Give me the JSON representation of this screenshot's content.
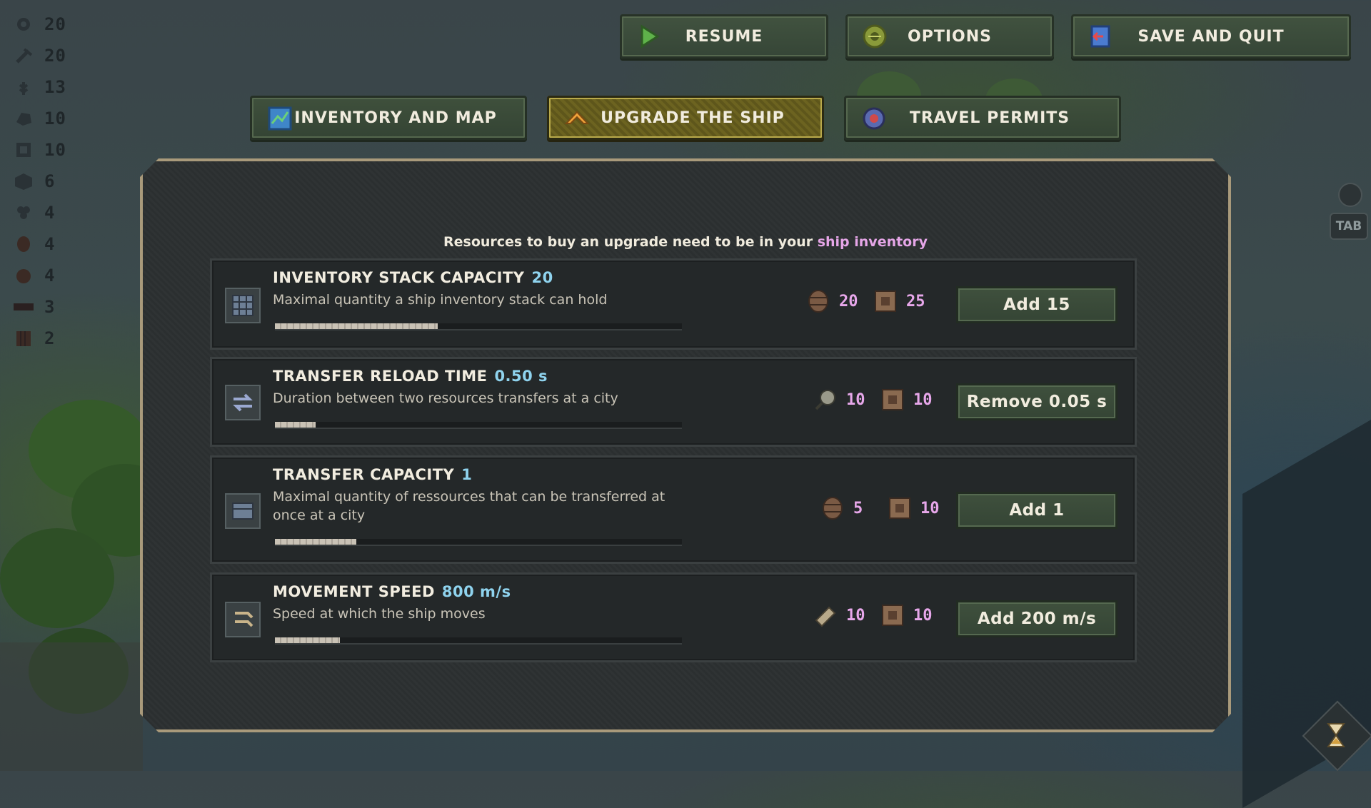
{
  "top_menu": {
    "resume_label": "RESUME",
    "options_label": "OPTIONS",
    "save_quit_label": "SAVE AND QUIT"
  },
  "tabs": [
    {
      "label": "INVENTORY AND MAP",
      "active": false
    },
    {
      "label": "UPGRADE THE SHIP",
      "active": true
    },
    {
      "label": "TRAVEL PERMITS",
      "active": false
    }
  ],
  "resource_hud": [
    {
      "icon": "gear-resource-icon",
      "value": "20"
    },
    {
      "icon": "pickaxe-resource-icon",
      "value": "20"
    },
    {
      "icon": "wheat-resource-icon",
      "value": "13"
    },
    {
      "icon": "ore-resource-icon",
      "value": "10"
    },
    {
      "icon": "crate-resource-icon",
      "value": "10"
    },
    {
      "icon": "box-resource-icon",
      "value": "6"
    },
    {
      "icon": "grapes-resource-icon",
      "value": "4"
    },
    {
      "icon": "barrel-resource-icon",
      "value": "4"
    },
    {
      "icon": "basket-resource-icon",
      "value": "4"
    },
    {
      "icon": "plank-resource-icon",
      "value": "3"
    },
    {
      "icon": "book-resource-icon",
      "value": "2"
    }
  ],
  "notice": {
    "text": "Resources to buy an upgrade need to be in your",
    "highlight": "ship inventory"
  },
  "upgrades": [
    {
      "title": "INVENTORY STACK CAPACITY",
      "value": "20",
      "description": "Maximal quantity a ship inventory stack can hold",
      "progress": 0.4,
      "costs": [
        {
          "icon": "barrel-resource-icon",
          "amount": "20"
        },
        {
          "icon": "crate-resource-icon",
          "amount": "25"
        }
      ],
      "button": "Add 15"
    },
    {
      "title": "TRANSFER RELOAD TIME",
      "value": "0.50 s",
      "description": "Duration between two resources transfers at a city",
      "progress": 0.1,
      "costs": [
        {
          "icon": "magnifier-resource-icon",
          "amount": "10"
        },
        {
          "icon": "crate-resource-icon",
          "amount": "10"
        }
      ],
      "button": "Remove 0.05 s"
    },
    {
      "title": "TRANSFER CAPACITY",
      "value": "1",
      "description": "Maximal quantity of ressources that can be transferred at once at a city",
      "progress": 0.2,
      "costs": [
        {
          "icon": "barrel-resource-icon",
          "amount": "5"
        },
        {
          "icon": "crate-resource-icon",
          "amount": "10"
        }
      ],
      "button": "Add 1"
    },
    {
      "title": "MOVEMENT SPEED",
      "value": "800 m/s",
      "description": "Speed at which the ship moves",
      "progress": 0.16,
      "costs": [
        {
          "icon": "plank-resource-icon",
          "amount": "10"
        },
        {
          "icon": "crate-resource-icon",
          "amount": "10"
        }
      ],
      "button": "Add 200 m/s"
    }
  ],
  "tab_key_label": "TAB",
  "colors": {
    "accent_value": "#8fd3ee",
    "cost_number": "#e7a7ea",
    "active_tab": "#6c6320"
  }
}
